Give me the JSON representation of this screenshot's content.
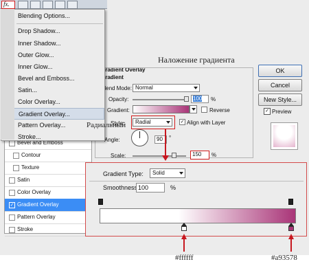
{
  "dialog": {
    "title_overlay": "Наложение градиента",
    "panel_title": "Gradient Overlay",
    "section_title": "Gradient",
    "blend_mode_label": "Blend Mode:",
    "blend_mode_value": "Normal",
    "opacity_label": "Opacity:",
    "opacity_value": "100",
    "opacity_unit": "%",
    "gradient_label": "Gradient:",
    "reverse_label": "Reverse",
    "reverse_checked": false,
    "style_label": "Style:",
    "style_value": "Radial",
    "align_label": "Align with Layer",
    "align_checked": true,
    "angle_label": "Angle:",
    "angle_value": "90",
    "angle_unit": "°",
    "scale_label": "Scale:",
    "scale_value": "150",
    "scale_unit": "%"
  },
  "buttons": {
    "ok": "OK",
    "cancel": "Cancel",
    "new_style": "New Style...",
    "preview": "Preview",
    "preview_checked": true
  },
  "fx_menu": {
    "fx_label": "fx.",
    "items": [
      "Blending Options...",
      "Drop Shadow...",
      "Inner Shadow...",
      "Outer Glow...",
      "Inner Glow...",
      "Bevel and Emboss...",
      "Satin...",
      "Color Overlay...",
      "Gradient Overlay...",
      "Pattern Overlay...",
      "Stroke..."
    ],
    "highlighted": "Gradient Overlay..."
  },
  "styles_list": [
    {
      "label": "Bevel and Emboss",
      "checked": false,
      "sub": false
    },
    {
      "label": "Contour",
      "checked": false,
      "sub": true
    },
    {
      "label": "Texture",
      "checked": false,
      "sub": true
    },
    {
      "label": "Satin",
      "checked": false,
      "sub": false
    },
    {
      "label": "Color Overlay",
      "checked": false,
      "sub": false
    },
    {
      "label": "Gradient Overlay",
      "checked": true,
      "sub": false
    },
    {
      "label": "Pattern Overlay",
      "checked": false,
      "sub": false
    },
    {
      "label": "Stroke",
      "checked": false,
      "sub": false
    }
  ],
  "gradient_editor": {
    "type_label": "Gradient Type:",
    "type_value": "Solid",
    "smoothness_label": "Smoothness:",
    "smoothness_value": "100",
    "smoothness_unit": "%",
    "start_color": "#ffffff",
    "end_color": "#a93578"
  },
  "annotations": {
    "radial": "Радиальный",
    "white_stop": "#ffffff",
    "pink_stop": "#a93578"
  }
}
